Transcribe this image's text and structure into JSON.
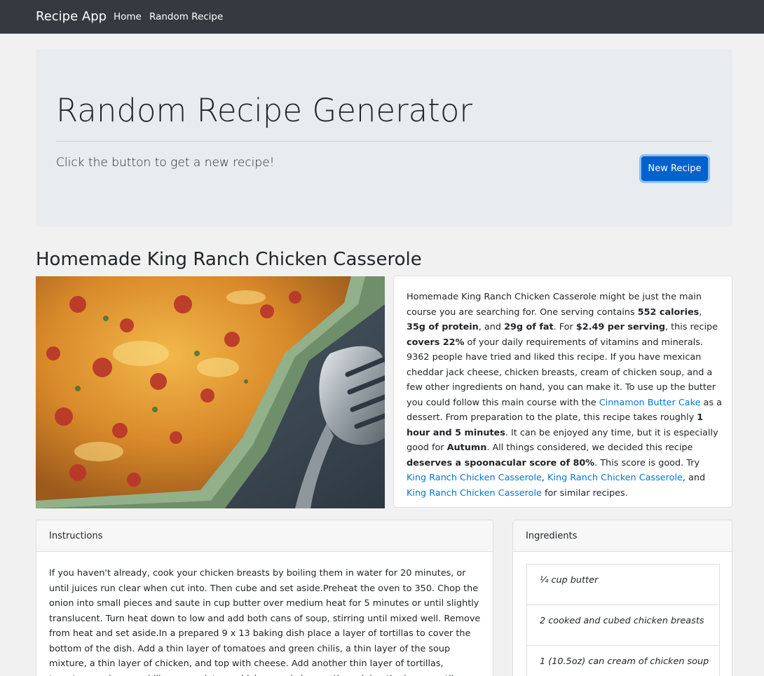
{
  "navbar": {
    "brand": "Recipe App",
    "links": [
      "Home",
      "Random Recipe"
    ]
  },
  "jumbotron": {
    "title": "Random Recipe Generator",
    "lead": "Click the button to get a new recipe!",
    "button_label": "New Recipe"
  },
  "recipe": {
    "title": "Homemade King Ranch Chicken Casserole",
    "summary": [
      {
        "t": "text",
        "v": "Homemade King Ranch Chicken Casserole might be just the main course you are searching for. One serving contains "
      },
      {
        "t": "bold",
        "v": "552 calories"
      },
      {
        "t": "text",
        "v": ", "
      },
      {
        "t": "bold",
        "v": "35g of protein"
      },
      {
        "t": "text",
        "v": ", and "
      },
      {
        "t": "bold",
        "v": "29g of fat"
      },
      {
        "t": "text",
        "v": ". For "
      },
      {
        "t": "bold",
        "v": "$2.49 per serving"
      },
      {
        "t": "text",
        "v": ", this recipe "
      },
      {
        "t": "bold",
        "v": "covers 22%"
      },
      {
        "t": "text",
        "v": " of your daily requirements of vitamins and minerals. 9362 people have tried and liked this recipe. If you have mexican cheddar jack cheese, chicken breasts, cream of chicken soup, and a few other ingredients on hand, you can make it. To use up the butter you could follow this main course with the "
      },
      {
        "t": "link",
        "v": "Cinnamon Butter Cake"
      },
      {
        "t": "text",
        "v": " as a dessert. From preparation to the plate, this recipe takes roughly "
      },
      {
        "t": "bold",
        "v": "1 hour and 5 minutes"
      },
      {
        "t": "text",
        "v": ". It can be enjoyed any time, but it is especially good for "
      },
      {
        "t": "bold",
        "v": "Autumn"
      },
      {
        "t": "text",
        "v": ". All things considered, we decided this recipe "
      },
      {
        "t": "bold",
        "v": "deserves a spoonacular score of 80%"
      },
      {
        "t": "text",
        "v": ". This score is good. Try "
      },
      {
        "t": "link",
        "v": "King Ranch Chicken Casserole"
      },
      {
        "t": "text",
        "v": ", "
      },
      {
        "t": "link",
        "v": "King Ranch Chicken Casserole"
      },
      {
        "t": "text",
        "v": ", and "
      },
      {
        "t": "link",
        "v": "King Ranch Chicken Casserole"
      },
      {
        "t": "text",
        "v": " for similar recipes."
      }
    ]
  },
  "instructions": {
    "header": "Instructions",
    "text": "If you haven't already, cook your chicken breasts by boiling them in water for 20 minutes, or until juices run clear when cut into. Then cube and set aside.Preheat the oven to 350. Chop the onion into small pieces and saute in cup butter over medium heat for 5 minutes or until slightly translucent. Turn heat down to low and add both cans of soup, stirring until mixed well. Remove from heat and set aside.In a prepared 9 x 13 baking dish place a layer of tortillas to cover the bottom of the dish. Add a thin layer of tomatoes and green chilis, a thin layer of the soup mixture, a thin layer of chicken, and top with cheese. Add another thin layer of tortillas, tomatoes and green chilis, soup mixture, chicken, and cheese. Keep doing the layers until you run out of space, finally"
  },
  "ingredients": {
    "header": "Ingredients",
    "items": [
      "¼ cup butter",
      "2 cooked and cubed chicken breasts",
      "1 (10.5oz) can cream of chicken soup"
    ]
  },
  "colors": {
    "navbar_bg": "#343a40",
    "primary": "#0062cc",
    "link": "#0275d8",
    "jumbotron_bg": "#e9ecef"
  }
}
